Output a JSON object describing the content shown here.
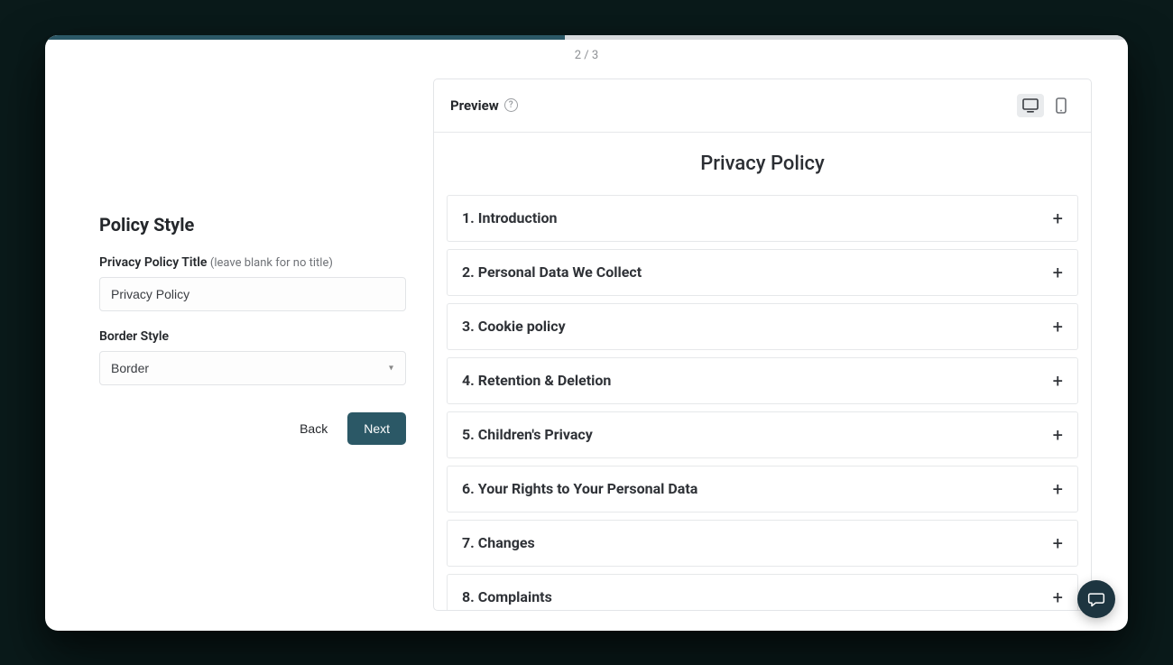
{
  "progress": {
    "step_label": "2 / 3",
    "percent": 48
  },
  "left": {
    "heading": "Policy Style",
    "title_field": {
      "label": "Privacy Policy Title",
      "hint": "(leave blank for no title)",
      "value": "Privacy Policy"
    },
    "border_field": {
      "label": "Border Style",
      "value": "Border"
    },
    "back_label": "Back",
    "next_label": "Next"
  },
  "preview": {
    "header_label": "Preview",
    "policy_title": "Privacy Policy",
    "sections": [
      "1. Introduction",
      "2. Personal Data We Collect",
      "3. Cookie policy",
      "4. Retention & Deletion",
      "5. Children's Privacy",
      "6. Your Rights to Your Personal Data",
      "7. Changes",
      "8. Complaints"
    ]
  }
}
